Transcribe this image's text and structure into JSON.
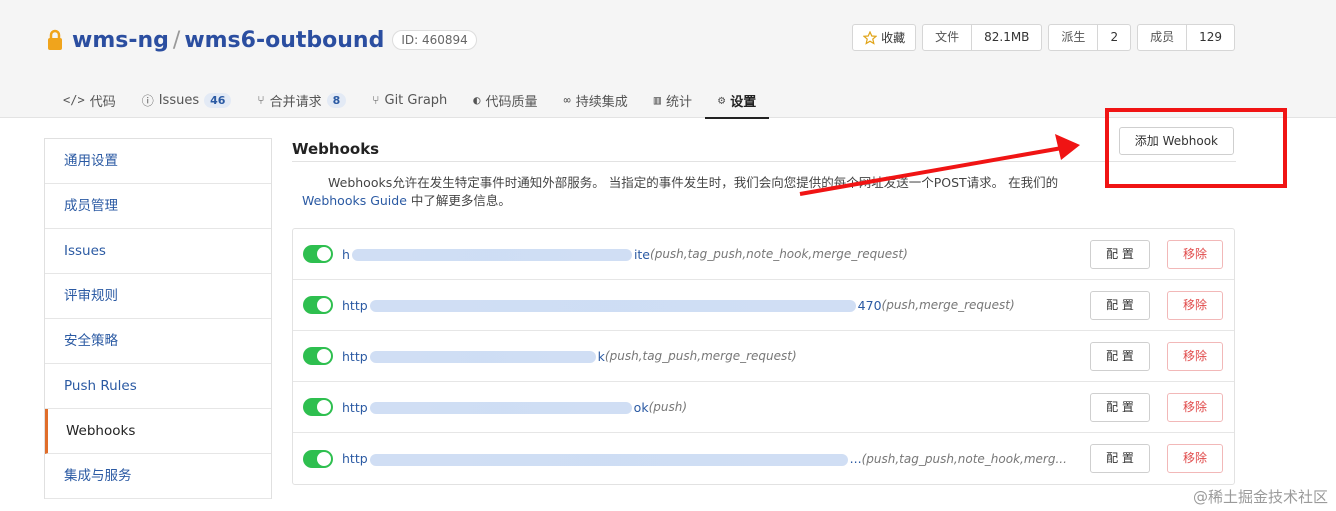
{
  "repo": {
    "namespace": "wms-ng",
    "separator": "/",
    "name": "wms6-outbound",
    "id_label": "ID: 460894"
  },
  "stats": {
    "star_label": "收藏",
    "files_label": "文件",
    "files_value": "82.1MB",
    "forks_label": "派生",
    "forks_value": "2",
    "members_label": "成员",
    "members_value": "129"
  },
  "tabs": [
    {
      "icon": "</>",
      "label": "代码"
    },
    {
      "icon": "ⓘ",
      "label": "Issues",
      "badge": "46"
    },
    {
      "icon": "⑂",
      "label": "合并请求",
      "badge": "8"
    },
    {
      "icon": "⑂",
      "label": "Git Graph"
    },
    {
      "icon": "◐",
      "label": "代码质量"
    },
    {
      "icon": "∞",
      "label": "持续集成"
    },
    {
      "icon": "▥",
      "label": "统计"
    },
    {
      "icon": "⚙",
      "label": "设置"
    }
  ],
  "sidebar": {
    "items": [
      {
        "label": "通用设置"
      },
      {
        "label": "成员管理"
      },
      {
        "label": "Issues"
      },
      {
        "label": "评审规则"
      },
      {
        "label": "安全策略"
      },
      {
        "label": "Push Rules"
      },
      {
        "label": "Webhooks"
      },
      {
        "label": "集成与服务"
      }
    ]
  },
  "main": {
    "title": "Webhooks",
    "add_button": "添加 Webhook",
    "desc_before": "Webhooks允许在发生特定事件时通知外部服务。 当指定的事件发生时，我们会向您提供的每个网址发送一个POST请求。 在我们的",
    "desc_link": "Webhooks Guide",
    "desc_after": "中了解更多信息。",
    "config_label": "配 置",
    "remove_label": "移除"
  },
  "hooks": [
    {
      "url_start": "h",
      "url_end": "ite",
      "events": "(push,tag_push,note_hook,merge_request)"
    },
    {
      "url_start": "http",
      "url_end": "470",
      "events": "(push,merge_request)"
    },
    {
      "url_start": "http",
      "url_end": "k",
      "events": "(push,tag_push,merge_request)"
    },
    {
      "url_start": "http",
      "url_end": "ok",
      "events": "(push)"
    },
    {
      "url_start": "http",
      "url_end": "...",
      "events": "(push,tag_push,note_hook,merg..."
    }
  ],
  "watermark": "@稀土掘金技术社区",
  "colors": {
    "link": "#2b5aa3",
    "toggle_on": "#2ebf4f",
    "remove": "#e04a4a",
    "annotation": "#f01414",
    "active_sidebar": "#e06d2a"
  }
}
